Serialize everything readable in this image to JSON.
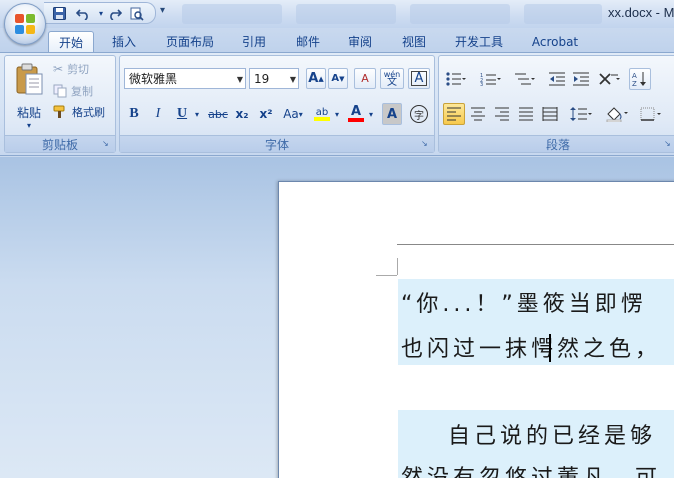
{
  "window": {
    "title": "xx.docx - M"
  },
  "quick_access": {
    "items": [
      "save-icon",
      "undo-icon",
      "redo-icon",
      "print-preview-icon"
    ],
    "more": "▾"
  },
  "ribbon_tabs": [
    "开始",
    "插入",
    "页面布局",
    "引用",
    "邮件",
    "审阅",
    "视图",
    "开发工具",
    "Acrobat"
  ],
  "clipboard": {
    "paste_label": "粘贴",
    "cut_label": "剪切",
    "copy_label": "复制",
    "format_painter_label": "格式刷",
    "group_label": "剪贴板"
  },
  "font": {
    "font_name": "微软雅黑",
    "font_size": "19",
    "grow": "A",
    "shrink": "A",
    "clear_format": "A",
    "phonetic": "wén",
    "border_char": "A",
    "bold": "B",
    "italic": "I",
    "underline": "U",
    "strikethrough": "abc",
    "subscript": "x₂",
    "superscript": "x²",
    "change_case": "Aa",
    "highlight": "ab",
    "font_color": "A",
    "char_shading": "A",
    "enclose": "字",
    "group_label": "字体"
  },
  "paragraph": {
    "group_label": "段落"
  },
  "document": {
    "line1": "“你...！”墨筱当即愣",
    "line2": "也闪过一抹愕然之色，",
    "line3": "自己说的已经是够",
    "line4": "然没有忽悠过董凡，可"
  },
  "colors": {
    "highlight_yellow": "#ffff00",
    "font_red": "#ff0000",
    "selection": "#dcf0fb"
  }
}
